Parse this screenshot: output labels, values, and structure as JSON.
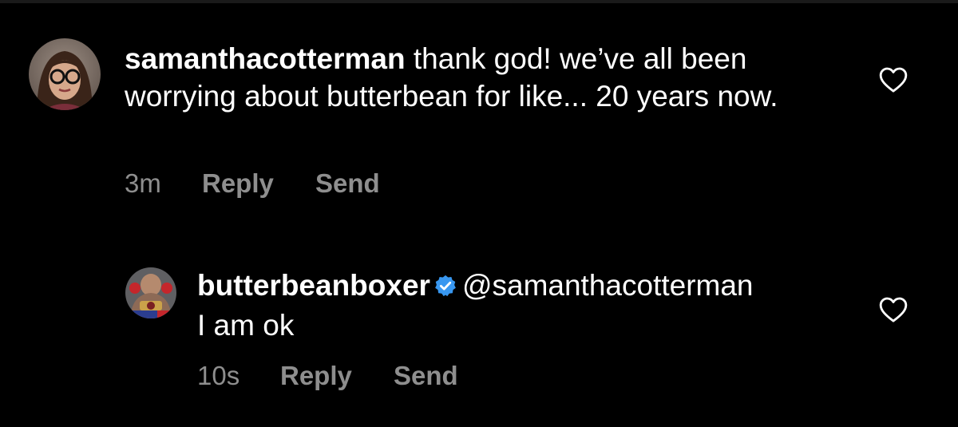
{
  "comments": [
    {
      "username": "samanthacotterman",
      "text": "thank god! we’ve all been worrying about butterbean for like... 20 years now.",
      "time": "3m",
      "reply_label": "Reply",
      "send_label": "Send",
      "avatar_icon": "profile-photo-woman-glasses",
      "like_icon": "heart-outline-icon"
    },
    {
      "username": "butterbeanboxer",
      "verified": true,
      "mention": "@samanthacotterman",
      "text": "I am ok",
      "time": "10s",
      "reply_label": "Reply",
      "send_label": "Send",
      "avatar_icon": "profile-photo-boxer",
      "like_icon": "heart-outline-icon"
    }
  ],
  "colors": {
    "background": "#000000",
    "text": "#ffffff",
    "meta": "#8e8e8e",
    "verified": "#3897f0"
  }
}
